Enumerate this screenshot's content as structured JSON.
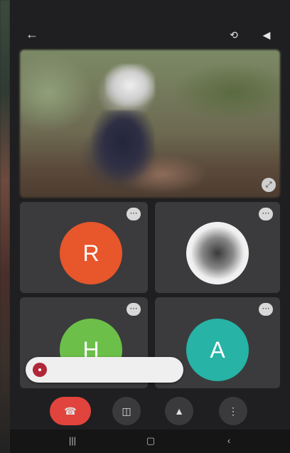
{
  "status_bar": {
    "time": "",
    "icons": ""
  },
  "header": {
    "title": "",
    "back_icon": "arrow-left-icon",
    "switch_camera_icon": "flip-camera-icon",
    "speaker_icon": "speaker-icon"
  },
  "participants": [
    {
      "name": "",
      "initial": "R",
      "color": "#e8562c"
    },
    {
      "name": "",
      "initial": "",
      "photo": true
    },
    {
      "name": "",
      "initial": "H",
      "color": "#6cc04a"
    },
    {
      "name": "",
      "initial": "A",
      "color": "#27b3a6"
    }
  ],
  "toast": {
    "line1": "",
    "line2": ""
  },
  "controls": {
    "end_icon": "end-call-icon",
    "video_icon": "video-off-icon",
    "mic_icon": "mic-icon",
    "more_icon": "more-icon"
  },
  "colors": {
    "end_call": "#e0443c",
    "tile_bg": "#3b3b3d",
    "screen_bg": "#1f1f21"
  }
}
